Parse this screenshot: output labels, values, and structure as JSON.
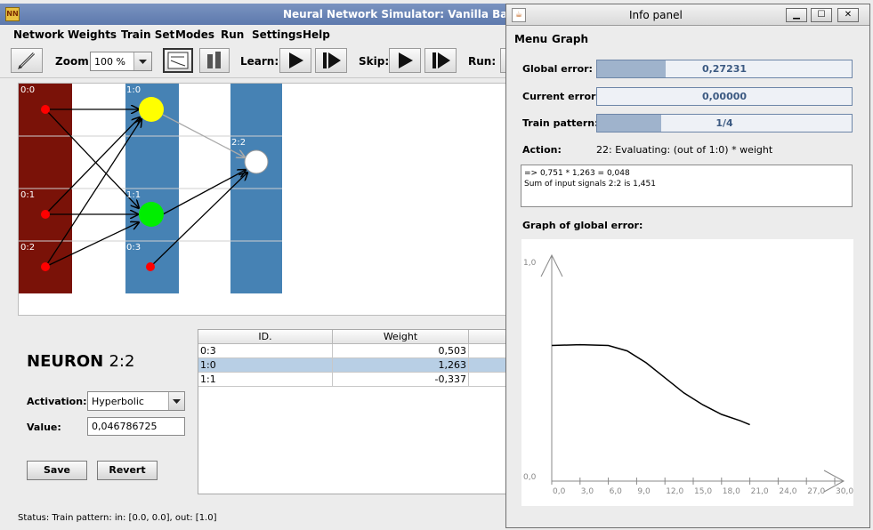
{
  "main_window": {
    "title": "Neural Network Simulator: Vanilla BackPropa",
    "app_icon_text": "NN"
  },
  "menubar": [
    "Network",
    "Weights",
    "Train Set",
    "Modes",
    "Run",
    "Settings",
    "Help"
  ],
  "toolbar": {
    "zoom_label": "Zoom:",
    "zoom_value": "100 %",
    "learn_label": "Learn:",
    "skip_label": "Skip:",
    "run_label": "Run:"
  },
  "network": {
    "nodes": [
      {
        "id": "0:0",
        "label": "0:0",
        "color": "#ff0000"
      },
      {
        "id": "0:1",
        "label": "0:1",
        "color": "#ff0000"
      },
      {
        "id": "0:2",
        "label": "0:2",
        "color": "#ff0000"
      },
      {
        "id": "1:0",
        "label": "1:0",
        "color": "#ffff00"
      },
      {
        "id": "1:1",
        "label": "1:1",
        "color": "#00ee00"
      },
      {
        "id": "0:3",
        "label": "0:3",
        "color": "#ff0000"
      },
      {
        "id": "2:2",
        "label": "2:2",
        "color": "#ffffff"
      }
    ],
    "colors": {
      "input_column": "#7a1208",
      "hidden_column": "#4682b4"
    }
  },
  "neuron": {
    "heading": "NEURON",
    "id": "2:2",
    "activation_label": "Activation:",
    "activation_value": "Hyperbolic",
    "value_label": "Value:",
    "value": "0,046786725",
    "save_label": "Save",
    "revert_label": "Revert"
  },
  "weights_table": {
    "columns": [
      "ID.",
      "Weight"
    ],
    "rows": [
      {
        "id": "0:3",
        "weight": "0,503",
        "selected": false
      },
      {
        "id": "1:0",
        "weight": "1,263",
        "selected": true
      },
      {
        "id": "1:1",
        "weight": "-0,337",
        "selected": false
      }
    ]
  },
  "status": "Status: Train pattern: in: [0.0, 0.0], out: [1.0]",
  "info_panel": {
    "title": "Info panel",
    "menu": [
      "Menu",
      "Graph"
    ],
    "global_error_label": "Global error:",
    "global_error_value": "0,27231",
    "global_error_fraction": 0.27,
    "current_error_label": "Current error:",
    "current_error_value": "0,00000",
    "current_error_fraction": 0.0,
    "train_pattern_label": "Train pattern:",
    "train_pattern_value": "1/4",
    "train_pattern_fraction": 0.25,
    "action_label": "Action:",
    "action_value": "22: Evaluating: (out of 1:0) * weight",
    "log_lines": [
      "=> 0,751 * 1,263 = 0,048",
      "Sum of input signals 2:2 is 1,451"
    ],
    "graph_title": "Graph of global error:"
  },
  "chart_data": {
    "type": "line",
    "title": "Graph of global error:",
    "xlabel": "",
    "ylabel": "",
    "x_ticks": [
      "0,0",
      "3,0",
      "6,0",
      "9,0",
      "12,0",
      "15,0",
      "18,0",
      "21,0",
      "24,0",
      "27,0",
      "30,0"
    ],
    "y_ticks": [
      "0,0",
      "1,0"
    ],
    "xlim": [
      0,
      30
    ],
    "ylim": [
      0,
      1
    ],
    "series": [
      {
        "x": [
          0,
          3,
          6,
          8,
          10,
          12,
          14,
          16,
          18,
          20,
          21
        ],
        "y": [
          0.63,
          0.634,
          0.63,
          0.605,
          0.55,
          0.48,
          0.41,
          0.355,
          0.31,
          0.28,
          0.262
        ]
      }
    ]
  }
}
